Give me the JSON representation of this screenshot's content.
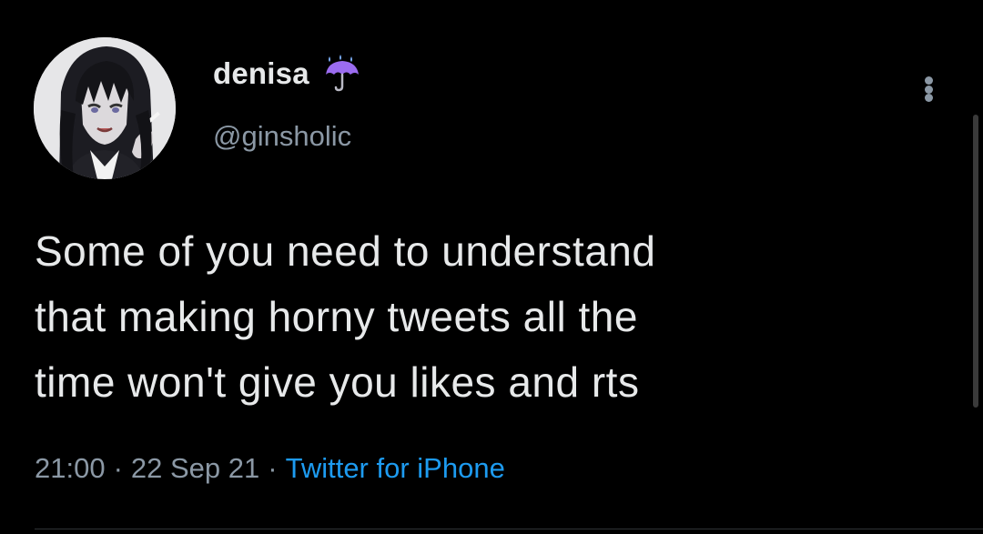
{
  "user": {
    "display_name": "denisa",
    "handle": "@ginsholic",
    "badge_icon": "umbrella-rain-icon"
  },
  "tweet": {
    "lines": [
      "Some of you need to understand",
      "that making horny tweets all the",
      "time won't give you likes and rts"
    ]
  },
  "meta": {
    "time": "21:00",
    "separator": "·",
    "date": "22 Sep 21",
    "source": "Twitter for iPhone"
  },
  "colors": {
    "background": "#000000",
    "primary_text": "#e7e9ea",
    "secondary_text": "#8b98a5",
    "link": "#1d9bf0",
    "badge": "#9b6cf0"
  }
}
